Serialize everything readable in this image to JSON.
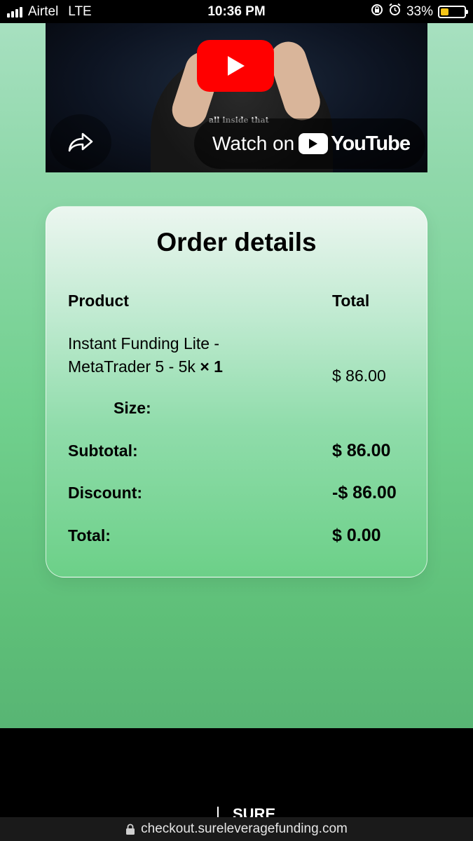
{
  "status_bar": {
    "carrier": "Airtel",
    "network": "LTE",
    "time": "10:36 PM",
    "battery_percent": "33%",
    "battery_level": 0.33
  },
  "video": {
    "caption": "all inside that",
    "watch_on": "Watch on",
    "youtube_label": "YouTube"
  },
  "order": {
    "title": "Order details",
    "col_product": "Product",
    "col_total": "Total",
    "item": {
      "name_line1": "Instant Funding Lite -",
      "name_line2": "MetaTrader 5 - 5k",
      "quantity": "× 1",
      "price": "$ 86.00",
      "size_label": "Size:"
    },
    "subtotal_label": "Subtotal:",
    "subtotal_value": "$ 86.00",
    "discount_label": "Discount:",
    "discount_value": "-$ 86.00",
    "total_label": "Total:",
    "total_value": "$ 0.00"
  },
  "footer": {
    "logo_text": "SURE"
  },
  "browser": {
    "url": "checkout.sureleveragefunding.com"
  }
}
